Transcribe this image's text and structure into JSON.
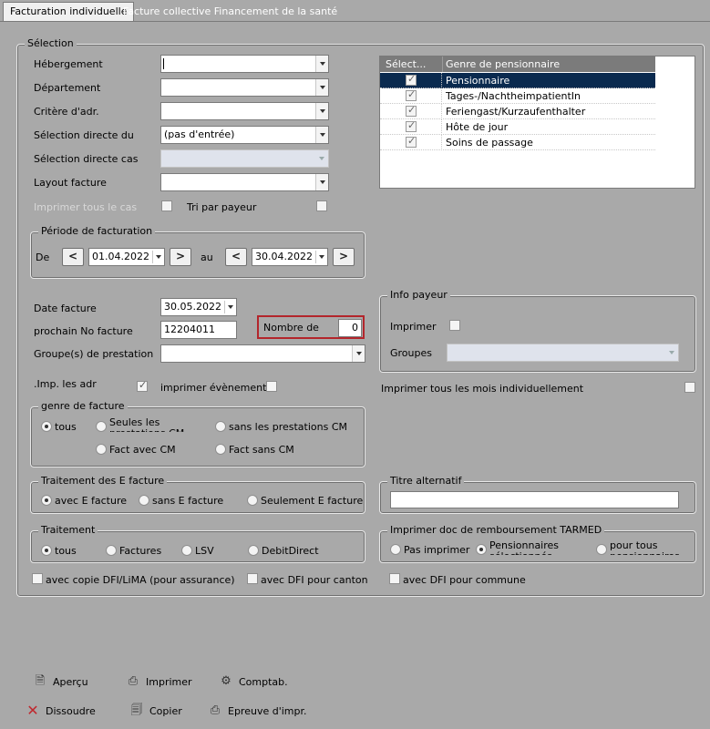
{
  "tabs": [
    {
      "label": "Facturation individuelle",
      "active": true
    },
    {
      "label": "Facture collective Financement de la santé",
      "active": false
    }
  ],
  "selection": {
    "title": "Sélection",
    "hebergement_label": "Hébergement",
    "hebergement_value": "",
    "departement_label": "Département",
    "critere_label": "Critère d'adr.",
    "selection_directe_du_label": "Sélection directe du",
    "selection_directe_du_value": "(pas d'entrée)",
    "selection_directe_cas_label": "Sélection directe cas",
    "layout_facture_label": "Layout facture",
    "imprimer_tous_label": "Imprimer tous le cas",
    "tri_payeur_label": "Tri par payeur"
  },
  "grid": {
    "headers": [
      "Sélect...",
      "Genre de pensionnaire"
    ],
    "rows": [
      {
        "label": "Pensionnaire",
        "checked": true,
        "selected": true
      },
      {
        "label": "Tages-/NachtheimpatientIn",
        "checked": true,
        "selected": false
      },
      {
        "label": "Feriengast/Kurzaufenthalter",
        "checked": true,
        "selected": false
      },
      {
        "label": "Hôte de jour",
        "checked": true,
        "selected": false
      },
      {
        "label": "Soins de passage",
        "checked": true,
        "selected": false
      }
    ]
  },
  "periode": {
    "title": "Période de facturation",
    "de_label": "De",
    "de_value": "01.04.2022",
    "au_label": "au",
    "au_value": "30.04.2022"
  },
  "facture": {
    "date_label": "Date facture",
    "date_value": "30.05.2022",
    "prochain_label": "prochain No facture",
    "prochain_value": "12204011",
    "nombre_label": "Nombre de",
    "nombre_value": "0",
    "groupes_label": "Groupe(s) de prestation",
    "imp_adr_label": ".Imp. les adr",
    "imprimer_evenements_label": "imprimer évènements"
  },
  "info_payeur": {
    "title": "Info payeur",
    "imprimer_label": "Imprimer",
    "groupes_label": "Groupes"
  },
  "imprimer_tous_mois_label": "Imprimer tous les mois individuellement",
  "genre_facture": {
    "title": "genre de facture",
    "opt_tous": "tous",
    "opt_seules": "Seules les prestations CM",
    "opt_sans_cm": "sans les prestations CM",
    "opt_avec_cm": "Fact avec CM",
    "opt_fact_sans_cm": "Fact sans CM"
  },
  "traitement_efacture": {
    "title": "Traitement des E facture",
    "opt_avec": "avec E facture",
    "opt_sans": "sans E facture",
    "opt_seulement": "Seulement E facture"
  },
  "titre_alternatif": {
    "title": "Titre alternatif",
    "value": ""
  },
  "traitement": {
    "title": "Traitement",
    "opt_tous": "tous",
    "opt_factures": "Factures",
    "opt_lsv": "LSV",
    "opt_debit": "DebitDirect"
  },
  "tarmed": {
    "title": "Imprimer doc de remboursement TARMED",
    "opt_pas": "Pas imprimer",
    "opt_pens_sel": "Pensionnaires sélectionnés",
    "opt_tous_pens": "pour tous pensionnaires"
  },
  "copies": {
    "dfi_lima": "avec copie DFI/LiMA (pour assurance)",
    "dfi_canton": "avec DFI pour canton",
    "dfi_commune": "avec DFI pour commune"
  },
  "toolbar": {
    "apercu": "Aperçu",
    "imprimer": "Imprimer",
    "comptab": "Comptab.",
    "dissoudre": "Dissoudre",
    "copier": "Copier",
    "epreuve": "Epreuve d'impr."
  }
}
